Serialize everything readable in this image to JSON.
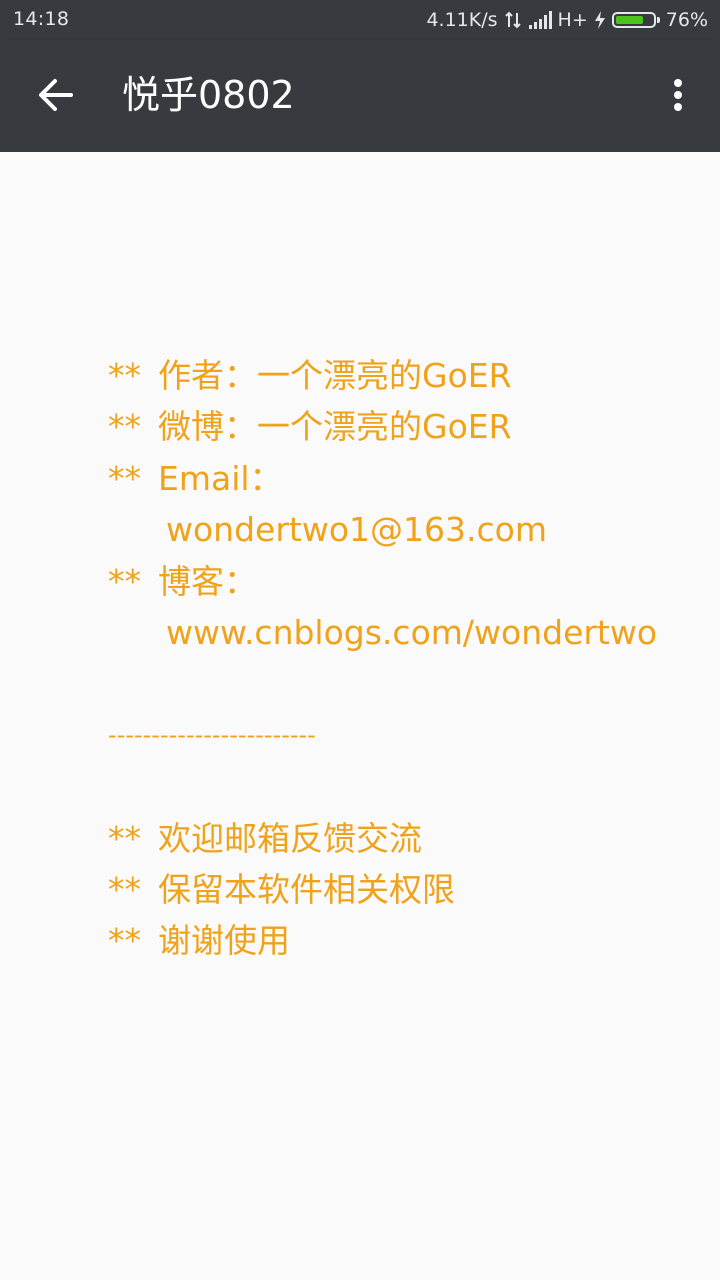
{
  "status_bar": {
    "time": "14:18",
    "net_speed": "4.11K/s",
    "network_type": "H+",
    "battery_percent": "76%",
    "battery_level": 0.76,
    "battery_color": "#4cc31a",
    "icons": [
      "data-arrows-icon",
      "signal-icon",
      "charge-icon",
      "battery-icon"
    ]
  },
  "app_bar": {
    "title": "悦乎0802",
    "background": "#373b40",
    "back_icon": "arrow-left-icon",
    "menu_icon": "more-vert-icon"
  },
  "content": {
    "text_color": "#f0a21a",
    "bullet": "**",
    "author": "作者：一个漂亮的GoER",
    "weibo": "微博：一个漂亮的GoER",
    "email_label": "Email：",
    "email_value": "wondertwo1@163.com",
    "blog_label": "博客：",
    "blog_value": "www.cnblogs.com/wondertwo",
    "divider": "------------------------",
    "feedback": "欢迎邮箱反馈交流",
    "rights": "保留本软件相关权限",
    "thanks": "谢谢使用"
  }
}
